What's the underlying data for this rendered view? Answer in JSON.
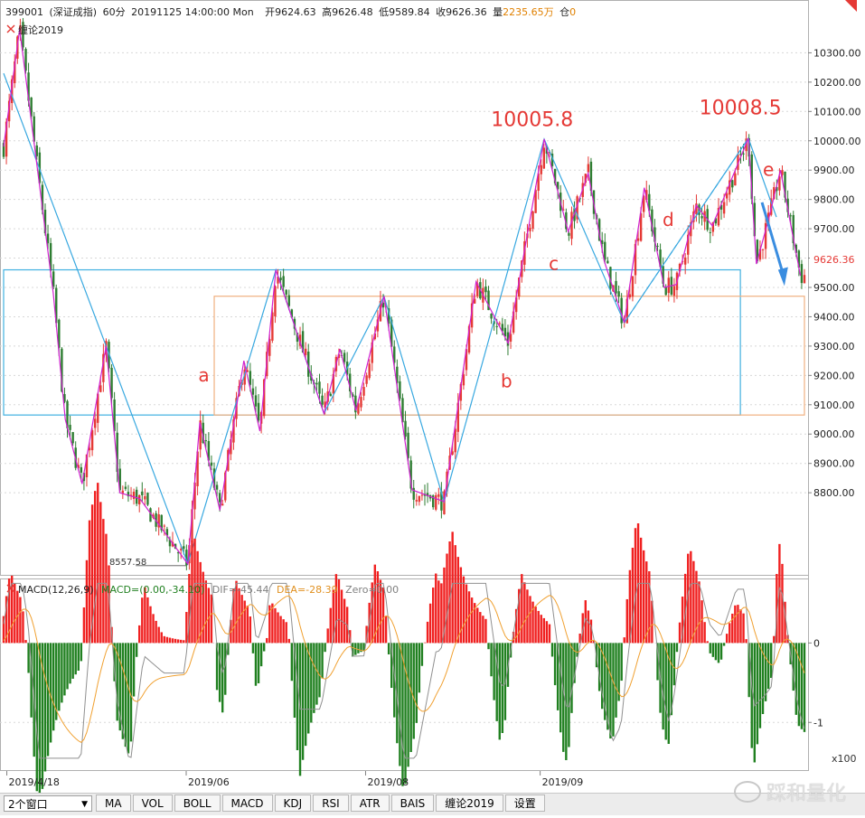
{
  "header": {
    "code": "399001",
    "name": "(深证成指)",
    "period": "60分",
    "datetime": "20191125 14:00:00 Mon",
    "open_label": "开",
    "open": "9624.63",
    "high_label": "高",
    "high": "9626.48",
    "low_label": "低",
    "low": "9589.84",
    "close_label": "收",
    "close": "9626.36",
    "volume_label": "量",
    "volume": "2235.65万",
    "position_label": "仓",
    "position": "0"
  },
  "indicator_label": "缠论2019",
  "macd_header": {
    "name": "MACD(12,26,9)",
    "macd": "MACD=(0.00,-34.10)",
    "dif": "DIF=-45.44",
    "dea": "DEA=-28.39",
    "zero": "Zero=0.00"
  },
  "x_labels": [
    "2019/4/18",
    "2019/06",
    "2019/08",
    "2019/09"
  ],
  "macd_y_labels": [
    "0",
    "-1"
  ],
  "macd_unit": "x100",
  "toolbar": {
    "window_select": "2个窗口",
    "buttons": [
      "MA",
      "VOL",
      "BOLL",
      "MACD",
      "KDJ",
      "RSI",
      "ATR",
      "BAIS",
      "缠论2019",
      "设置"
    ]
  },
  "watermark": "踩和量化",
  "colors": {
    "up": "#e53935",
    "down": "#2e7d32",
    "stroke": "#d020d0",
    "segment": "#38a8e0",
    "macd_pos": "#f02020",
    "macd_neg": "#208020",
    "dif": "#909090",
    "dea": "#f0a030",
    "annotation": "#e53935",
    "orange_box": "#f0b080",
    "blue_box": "#40b0e0"
  },
  "chart_data": {
    "type": "candlestick",
    "ylim": [
      8520,
      10480
    ],
    "yticks": [
      10300,
      10200,
      10100,
      10000,
      9900,
      9800,
      9700,
      9600,
      9500,
      9400,
      9300,
      9200,
      9100,
      9000,
      8900,
      8800
    ],
    "ytick_labels": [
      "10300.00",
      "10200.00",
      "10100.00",
      "10000.00",
      "9900.00",
      "9800.00",
      "9700.00",
      "9600.00",
      "9500.00",
      "9400.00",
      "9300.00",
      "9200.00",
      "9100.00",
      "9000.00",
      "8900.00",
      "8800.00"
    ],
    "last_price": 9626.36,
    "last_price_label": "9626.36",
    "low_marker": {
      "price": 8557.58,
      "label": "8557.58"
    },
    "annotations": [
      {
        "text": "10005.8",
        "price": 10005.8
      },
      {
        "text": "10008.5",
        "price": 10008.5
      },
      {
        "text": "a"
      },
      {
        "text": "b"
      },
      {
        "text": "c"
      },
      {
        "text": "d"
      },
      {
        "text": "e"
      }
    ],
    "stroke_points": [
      {
        "t": 0.0,
        "p": 9980
      },
      {
        "t": 0.02,
        "p": 10380
      },
      {
        "t": 0.062,
        "p": 9480
      },
      {
        "t": 0.077,
        "p": 9050
      },
      {
        "t": 0.098,
        "p": 8830
      },
      {
        "t": 0.128,
        "p": 9300
      },
      {
        "t": 0.145,
        "p": 8800
      },
      {
        "t": 0.17,
        "p": 8780
      },
      {
        "t": 0.23,
        "p": 8557.58
      },
      {
        "t": 0.245,
        "p": 9040
      },
      {
        "t": 0.27,
        "p": 8740
      },
      {
        "t": 0.3,
        "p": 9250
      },
      {
        "t": 0.32,
        "p": 9010
      },
      {
        "t": 0.34,
        "p": 9560
      },
      {
        "t": 0.4,
        "p": 9070
      },
      {
        "t": 0.42,
        "p": 9290
      },
      {
        "t": 0.44,
        "p": 9080
      },
      {
        "t": 0.475,
        "p": 9470
      },
      {
        "t": 0.51,
        "p": 8810
      },
      {
        "t": 0.55,
        "p": 8770
      },
      {
        "t": 0.59,
        "p": 9520
      },
      {
        "t": 0.63,
        "p": 9310
      },
      {
        "t": 0.675,
        "p": 10005.8
      },
      {
        "t": 0.705,
        "p": 9690
      },
      {
        "t": 0.73,
        "p": 9890
      },
      {
        "t": 0.75,
        "p": 9590
      },
      {
        "t": 0.775,
        "p": 9380
      },
      {
        "t": 0.8,
        "p": 9840
      },
      {
        "t": 0.825,
        "p": 9500
      },
      {
        "t": 0.84,
        "p": 9510
      },
      {
        "t": 0.865,
        "p": 9780
      },
      {
        "t": 0.885,
        "p": 9710
      },
      {
        "t": 0.93,
        "p": 10008.5
      },
      {
        "t": 0.94,
        "p": 9580
      },
      {
        "t": 0.955,
        "p": 9730
      },
      {
        "t": 0.97,
        "p": 9900
      },
      {
        "t": 0.995,
        "p": 9540
      }
    ],
    "segment_points": [
      {
        "t": 0.0,
        "p": 10230
      },
      {
        "t": 0.128,
        "p": 9300
      },
      {
        "t": 0.23,
        "p": 8557.58
      },
      {
        "t": 0.34,
        "p": 9560
      },
      {
        "t": 0.4,
        "p": 9070
      },
      {
        "t": 0.475,
        "p": 9470
      },
      {
        "t": 0.55,
        "p": 8770
      },
      {
        "t": 0.675,
        "p": 10005.8
      },
      {
        "t": 0.775,
        "p": 9380
      },
      {
        "t": 0.93,
        "p": 10008.5
      },
      {
        "t": 0.965,
        "p": 9740
      }
    ],
    "zones": [
      {
        "t_start": 0.0,
        "t_end": 0.92,
        "p_top": 9560,
        "p_bottom": 9065,
        "color": "blue_box"
      },
      {
        "t_start": 0.263,
        "t_end": 1.0,
        "p_top": 9470,
        "p_bottom": 9065,
        "color": "orange_box"
      }
    ],
    "macd": {
      "ylim": [
        -1.6,
        0.8
      ],
      "yticks": [
        0,
        -1
      ]
    }
  }
}
